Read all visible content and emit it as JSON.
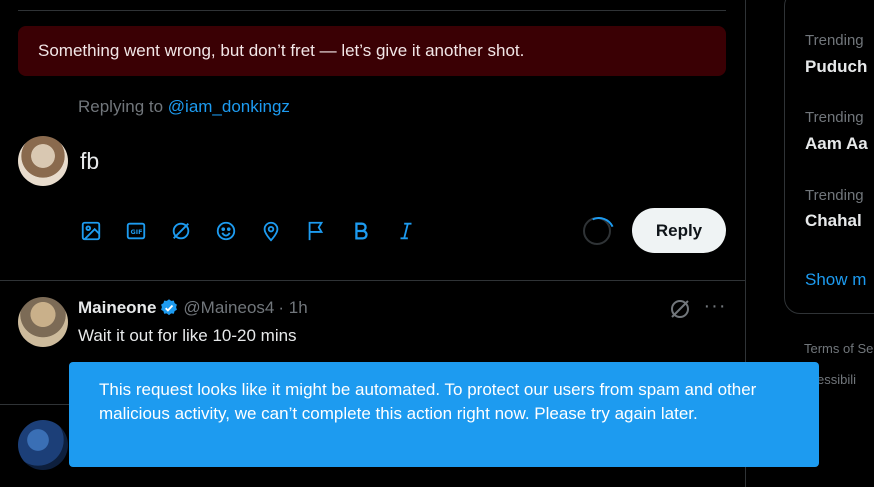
{
  "error_banner": {
    "text": "Something went wrong, but don’t fret — let’s give it another shot."
  },
  "compose": {
    "replying_prefix": "Replying to ",
    "replying_handle": "@iam_donkingz",
    "text": "fb",
    "reply_label": "Reply",
    "tools": [
      "image-icon",
      "gif-icon",
      "grok-icon",
      "emoji-icon",
      "location-icon",
      "flag-icon",
      "bold-icon",
      "italic-icon"
    ]
  },
  "post": {
    "name": "Maineone",
    "handle": "@Maineos4",
    "time": "· 1h",
    "text": "Wait it out for like 10-20 mins"
  },
  "trends": [
    {
      "meta": "Trending",
      "name": "Puduch"
    },
    {
      "meta": "Trending",
      "name": "Aam Aa"
    },
    {
      "meta": "Trending",
      "name": "Chahal"
    }
  ],
  "show_more": "Show m",
  "footer": {
    "terms": "Terms of Se",
    "accessibility": "ccessibili"
  },
  "toast": {
    "text": "This request looks like it might be automated. To protect our users from spam and other malicious activity, we can’t complete this action right now. Please try again later."
  },
  "colors": {
    "accent": "#1d9bf0",
    "error_bg": "#3a0004",
    "muted": "#71767b"
  }
}
